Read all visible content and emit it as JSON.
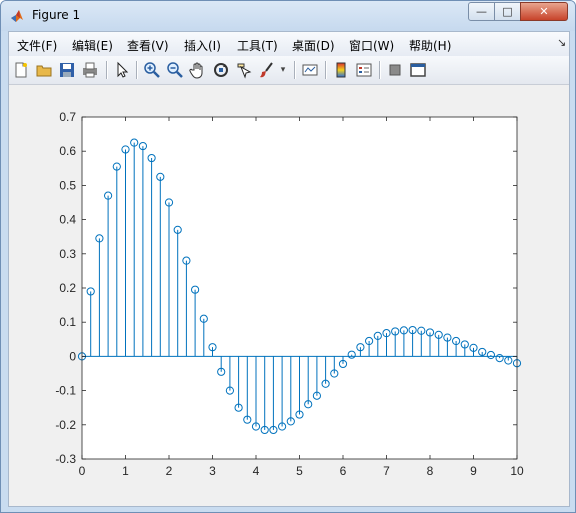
{
  "window": {
    "title": "Figure 1",
    "buttons": {
      "minimize": "—",
      "maximize": "□",
      "close": "✕"
    }
  },
  "menubar": {
    "items": [
      {
        "label": "文件(F)",
        "name": "menu-file"
      },
      {
        "label": "编辑(E)",
        "name": "menu-edit"
      },
      {
        "label": "查看(V)",
        "name": "menu-view"
      },
      {
        "label": "插入(I)",
        "name": "menu-insert"
      },
      {
        "label": "工具(T)",
        "name": "menu-tools"
      },
      {
        "label": "桌面(D)",
        "name": "menu-desktop"
      },
      {
        "label": "窗口(W)",
        "name": "menu-window"
      },
      {
        "label": "帮助(H)",
        "name": "menu-help"
      }
    ],
    "overflow_arrow": "↘"
  },
  "toolbar": {
    "icons": [
      "new-figure-icon",
      "open-file-icon",
      "save-icon",
      "print-icon",
      "edit-plot-arrow-icon",
      "zoom-in-icon",
      "zoom-out-icon",
      "pan-hand-icon",
      "rotate-3d-icon",
      "data-cursor-icon",
      "brush-icon",
      "brush-dropdown-icon",
      "link-plot-icon",
      "colorbar-icon",
      "legend-icon",
      "hide-plot-tools-icon",
      "show-plot-tools-icon"
    ]
  },
  "colors": {
    "stem": "#0072bd",
    "axes_bg": "#ffffff",
    "figure_bg": "#f0f0f0"
  },
  "chart_data": {
    "type": "stem",
    "title": "",
    "xlabel": "",
    "ylabel": "",
    "xlim": [
      0,
      10
    ],
    "ylim": [
      -0.3,
      0.7
    ],
    "xticks": [
      0,
      1,
      2,
      3,
      4,
      5,
      6,
      7,
      8,
      9,
      10
    ],
    "yticks": [
      -0.3,
      -0.2,
      -0.1,
      0,
      0.1,
      0.2,
      0.3,
      0.4,
      0.5,
      0.6,
      0.7
    ],
    "ytick_labels": [
      "-0.3",
      "-0.2",
      "-0.1",
      "0",
      "0.1",
      "0.2",
      "0.3",
      "0.4",
      "0.5",
      "0.6",
      "0.7"
    ],
    "marker": "circle",
    "grid": false,
    "x": [
      0,
      0.2,
      0.4,
      0.6,
      0.8,
      1.0,
      1.2,
      1.4,
      1.6,
      1.8,
      2.0,
      2.2,
      2.4,
      2.6,
      2.8,
      3.0,
      3.2,
      3.4,
      3.6,
      3.8,
      4.0,
      4.2,
      4.4,
      4.6,
      4.8,
      5.0,
      5.2,
      5.4,
      5.6,
      5.8,
      6.0,
      6.2,
      6.4,
      6.6,
      6.8,
      7.0,
      7.2,
      7.4,
      7.6,
      7.8,
      8.0,
      8.2,
      8.4,
      8.6,
      8.8,
      9.0,
      9.2,
      9.4,
      9.6,
      9.8,
      10.0
    ],
    "y": [
      0,
      0.19,
      0.345,
      0.47,
      0.555,
      0.605,
      0.625,
      0.615,
      0.58,
      0.525,
      0.45,
      0.37,
      0.28,
      0.195,
      0.11,
      0.027,
      -0.045,
      -0.1,
      -0.15,
      -0.185,
      -0.205,
      -0.215,
      -0.215,
      -0.205,
      -0.19,
      -0.17,
      -0.14,
      -0.115,
      -0.08,
      -0.05,
      -0.022,
      0.005,
      0.027,
      0.045,
      0.06,
      0.068,
      0.073,
      0.076,
      0.077,
      0.075,
      0.07,
      0.063,
      0.055,
      0.045,
      0.035,
      0.025,
      0.013,
      0.004,
      -0.005,
      -0.012,
      -0.02
    ]
  }
}
